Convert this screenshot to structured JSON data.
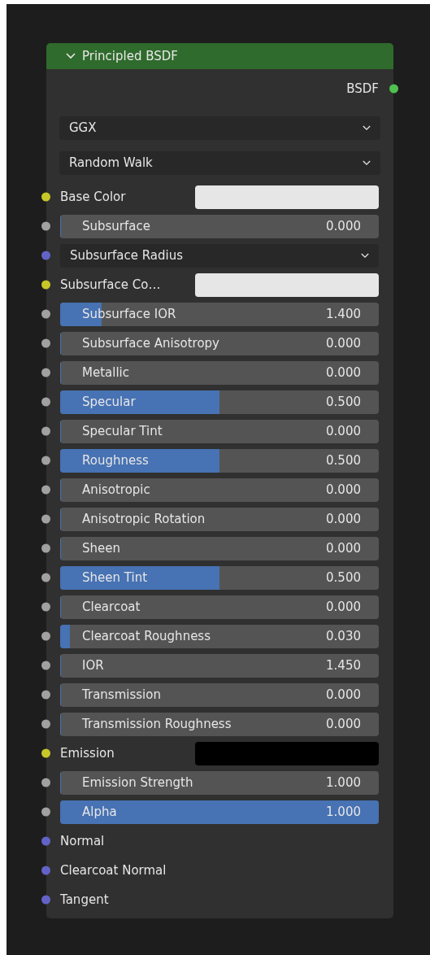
{
  "node": {
    "title": "Principled BSDF",
    "expanded": true,
    "outputs": [
      {
        "label": "BSDF",
        "color": "#4fc14f"
      }
    ],
    "dropdowns": [
      {
        "value": "GGX"
      },
      {
        "value": "Random Walk"
      }
    ],
    "inputs": [
      {
        "kind": "color",
        "label": "Base Color",
        "color": "#c7c729",
        "swatch": {
          "color": "#e6e6e6"
        }
      },
      {
        "kind": "value",
        "label": "Subsurface",
        "color": "#a1a1a1",
        "value": "0.000",
        "level": 0
      },
      {
        "kind": "menu",
        "label": "Subsurface Radius",
        "color": "#6363c7"
      },
      {
        "kind": "color",
        "label": "Subsurface Co…",
        "color": "#c7c729",
        "swatch": {
          "color": "#e6e6e6"
        }
      },
      {
        "kind": "value",
        "label": "Subsurface IOR",
        "color": "#a1a1a1",
        "value": "1.400",
        "level": 0.13
      },
      {
        "kind": "value",
        "label": "Subsurface Anisotropy",
        "color": "#a1a1a1",
        "value": "0.000",
        "level": 0
      },
      {
        "kind": "value",
        "label": "Metallic",
        "color": "#a1a1a1",
        "value": "0.000",
        "level": 0
      },
      {
        "kind": "value",
        "label": "Specular",
        "color": "#a1a1a1",
        "value": "0.500",
        "level": 0.5
      },
      {
        "kind": "value",
        "label": "Specular Tint",
        "color": "#a1a1a1",
        "value": "0.000",
        "level": 0
      },
      {
        "kind": "value",
        "label": "Roughness",
        "color": "#a1a1a1",
        "value": "0.500",
        "level": 0.5
      },
      {
        "kind": "value",
        "label": "Anisotropic",
        "color": "#a1a1a1",
        "value": "0.000",
        "level": 0
      },
      {
        "kind": "value",
        "label": "Anisotropic Rotation",
        "color": "#a1a1a1",
        "value": "0.000",
        "level": 0
      },
      {
        "kind": "value",
        "label": "Sheen",
        "color": "#a1a1a1",
        "value": "0.000",
        "level": 0
      },
      {
        "kind": "value",
        "label": "Sheen Tint",
        "color": "#a1a1a1",
        "value": "0.500",
        "level": 0.5
      },
      {
        "kind": "value",
        "label": "Clearcoat",
        "color": "#a1a1a1",
        "value": "0.000",
        "level": 0
      },
      {
        "kind": "value",
        "label": "Clearcoat Roughness",
        "color": "#a1a1a1",
        "value": "0.030",
        "level": 0.03
      },
      {
        "kind": "value",
        "label": "IOR",
        "color": "#a1a1a1",
        "value": "1.450",
        "level": 0
      },
      {
        "kind": "value",
        "label": "Transmission",
        "color": "#a1a1a1",
        "value": "0.000",
        "level": 0
      },
      {
        "kind": "value",
        "label": "Transmission Roughness",
        "color": "#a1a1a1",
        "value": "0.000",
        "level": 0
      },
      {
        "kind": "color",
        "label": "Emission",
        "color": "#c7c729",
        "swatch": {
          "color": "#000000"
        }
      },
      {
        "kind": "value",
        "label": "Emission Strength",
        "color": "#a1a1a1",
        "value": "1.000",
        "level": 0
      },
      {
        "kind": "value",
        "label": "Alpha",
        "color": "#a1a1a1",
        "value": "1.000",
        "level": 1
      },
      {
        "kind": "vector",
        "label": "Normal",
        "color": "#6363c7"
      },
      {
        "kind": "vector",
        "label": "Clearcoat Normal",
        "color": "#6363c7"
      },
      {
        "kind": "vector",
        "label": "Tangent",
        "color": "#6363c7"
      }
    ]
  }
}
